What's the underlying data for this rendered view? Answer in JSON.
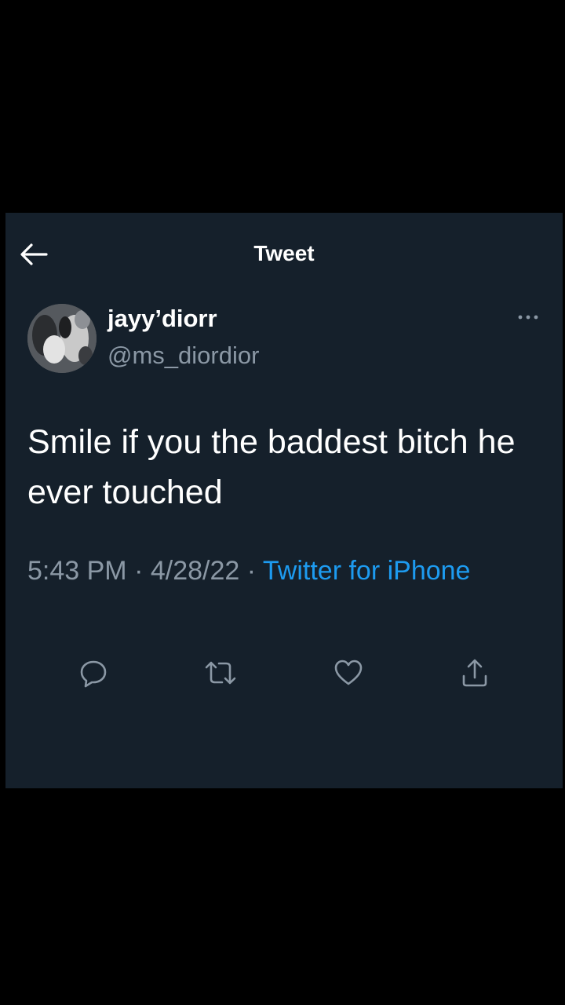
{
  "header": {
    "title": "Tweet",
    "back_icon": "arrow-left-icon"
  },
  "tweet": {
    "display_name": "jayy’diorr",
    "handle": "@ms_diordior",
    "text": "Smile if you the baddest bitch he ever touched",
    "time": "5:43 PM",
    "date": "4/28/22",
    "separator": " · ",
    "source": "Twitter for iPhone"
  },
  "actions": [
    "reply-icon",
    "retweet-icon",
    "like-icon",
    "share-icon"
  ],
  "colors": {
    "background": "#15202b",
    "outer": "#000000",
    "text": "#ffffff",
    "secondary": "#8b98a5",
    "link": "#1d9bf0"
  }
}
